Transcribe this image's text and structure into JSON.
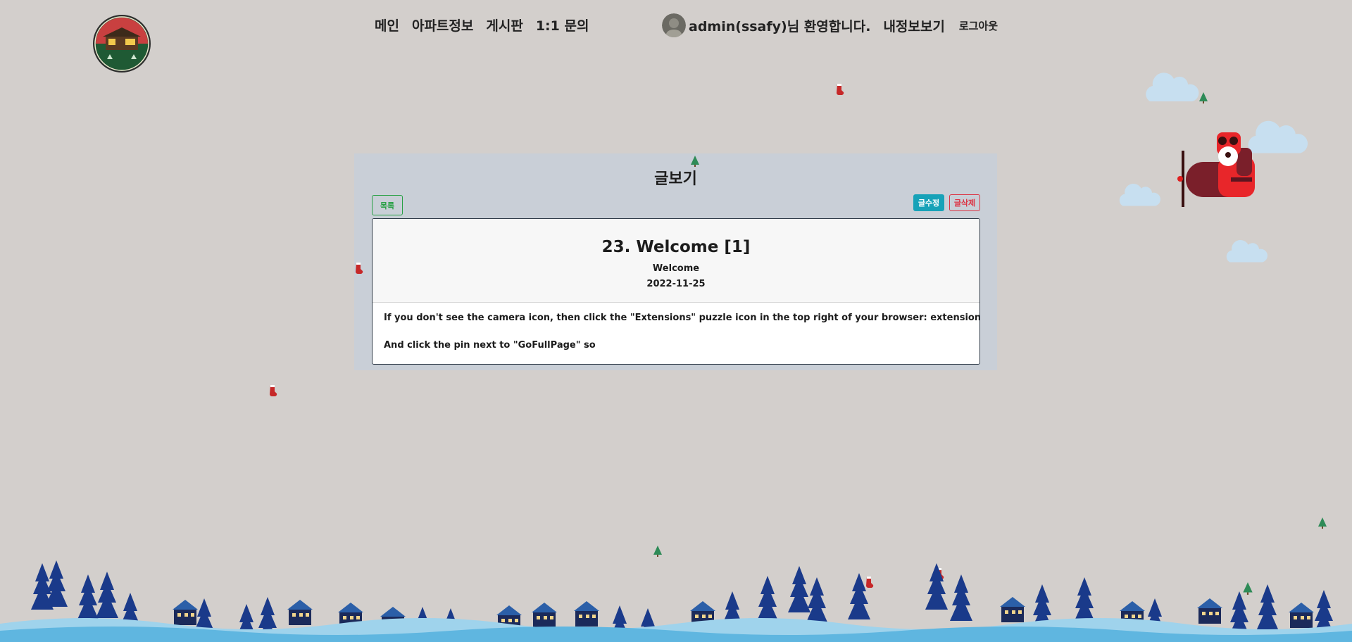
{
  "nav": {
    "items": [
      "메인",
      "아파트정보",
      "게시판",
      "1:1 문의"
    ]
  },
  "user": {
    "welcome": "admin(ssafy)님 환영합니다.",
    "mypage": "내정보보기",
    "logout": "로그아웃"
  },
  "panel": {
    "title": "글보기",
    "list_button": "목록",
    "edit_button": "글수정",
    "delete_button": "글삭제"
  },
  "article": {
    "title": "23. Welcome [1]",
    "writer": "Welcome",
    "date": "2022-11-25",
    "paragraphs": [
      "If you don't see the camera icon, then click the \"Extensions\" puzzle icon in the top right of your browser: extensions puzzle icon",
      "And click the pin next to \"GoFullPage\" so"
    ]
  },
  "colors": {
    "background": "#d3cfcc",
    "panel": "#c9cfd7",
    "list_button": "#27a044",
    "edit_button": "#17a2b8",
    "delete_button": "#dc3545"
  }
}
